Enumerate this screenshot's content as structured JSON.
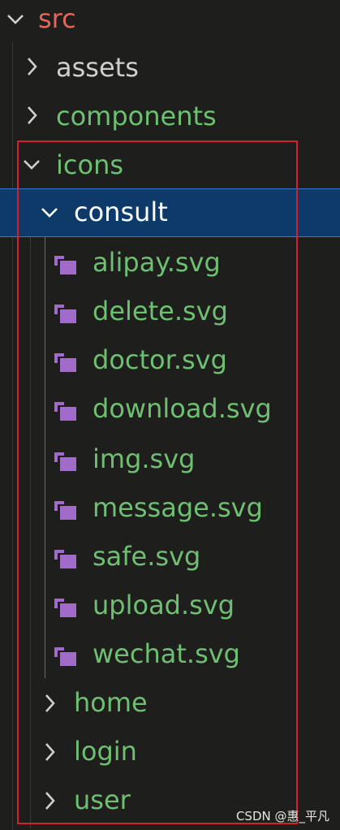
{
  "colors": {
    "src_text": "#e0675d",
    "folder_text": "#cfcfcf",
    "green_text": "#6fbf73",
    "svg_icon": "#a06bc9",
    "selection_bg": "#0d3a68",
    "selection_border": "#2f7bd6",
    "annotation_box": "#d4212f"
  },
  "tree": {
    "root": {
      "label": "src",
      "icon": "chevron-down-icon"
    },
    "assets": {
      "label": "assets",
      "icon": "chevron-right-icon"
    },
    "components": {
      "label": "components",
      "icon": "chevron-right-icon"
    },
    "icons": {
      "label": "icons",
      "icon": "chevron-down-icon"
    },
    "consult": {
      "label": "consult",
      "icon": "chevron-down-icon",
      "selected": true
    },
    "files": [
      {
        "label": "alipay.svg",
        "icon": "svg-file-icon"
      },
      {
        "label": "delete.svg",
        "icon": "svg-file-icon"
      },
      {
        "label": "doctor.svg",
        "icon": "svg-file-icon"
      },
      {
        "label": "download.svg",
        "icon": "svg-file-icon"
      },
      {
        "label": "img.svg",
        "icon": "svg-file-icon"
      },
      {
        "label": "message.svg",
        "icon": "svg-file-icon"
      },
      {
        "label": "safe.svg",
        "icon": "svg-file-icon"
      },
      {
        "label": "upload.svg",
        "icon": "svg-file-icon"
      },
      {
        "label": "wechat.svg",
        "icon": "svg-file-icon"
      }
    ],
    "home": {
      "label": "home",
      "icon": "chevron-right-icon"
    },
    "login": {
      "label": "login",
      "icon": "chevron-right-icon"
    },
    "user": {
      "label": "user",
      "icon": "chevron-right-icon"
    }
  },
  "watermark": "CSDN @惠_平凡"
}
